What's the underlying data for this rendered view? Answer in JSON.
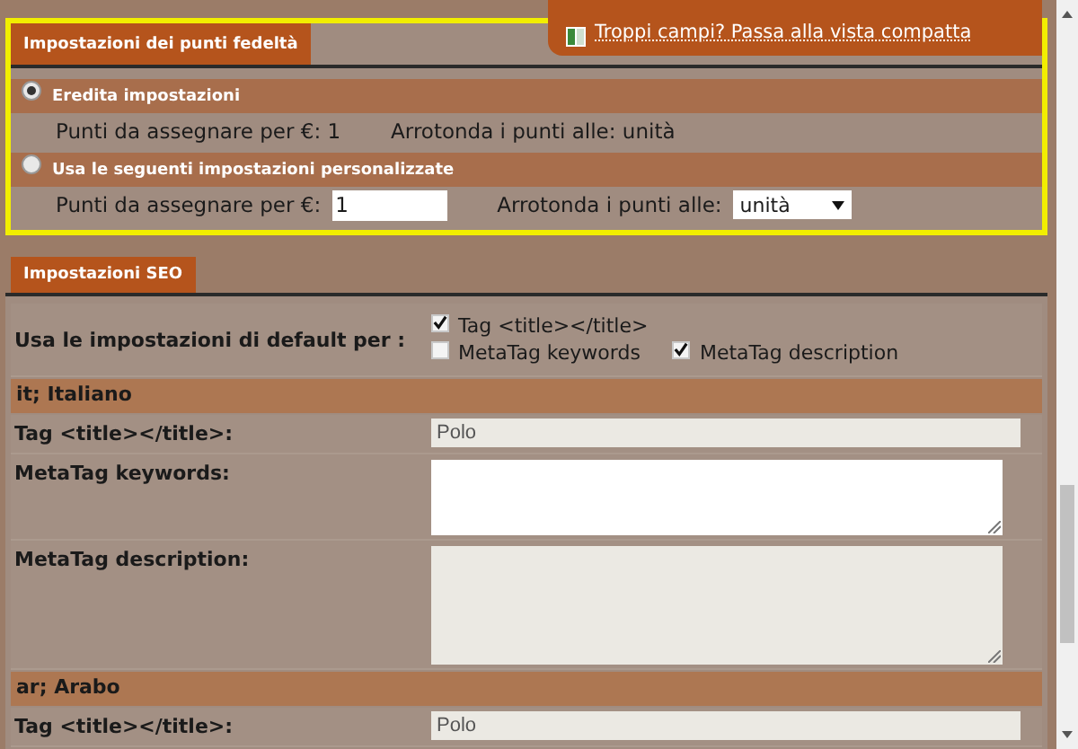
{
  "compact_link": {
    "text": "Troppi campi? Passa alla vista compatta"
  },
  "loyalty": {
    "tab": "Impostazioni dei punti fedeltà",
    "options": [
      {
        "label": "Eredita impostazioni",
        "selected": true,
        "kind": "summary",
        "points_label": "Punti da assegnare per €: 1",
        "round_label": "Arrotonda i punti alle: unità"
      },
      {
        "label": "Usa le seguenti impostazioni personalizzate",
        "selected": false,
        "kind": "form",
        "points_label": "Punti da assegnare per €:",
        "points_value": "1",
        "round_label": "Arrotonda i punti alle:",
        "round_value": "unità"
      }
    ]
  },
  "seo": {
    "tab": "Impostazioni SEO",
    "defaults_label": "Usa le impostazioni di default per :",
    "defaults": [
      {
        "label": "Tag <title></title>",
        "checked": true
      },
      {
        "label": "MetaTag keywords",
        "checked": false
      },
      {
        "label": "MetaTag description",
        "checked": true
      }
    ],
    "languages": [
      {
        "name": "it; Italiano",
        "fields": [
          {
            "label": "Tag <title></title>:",
            "kind": "line",
            "value": "Polo",
            "disabled": true
          },
          {
            "label": "MetaTag keywords:",
            "kind": "area",
            "disabled": false
          },
          {
            "label": "MetaTag description:",
            "kind": "area",
            "disabled": true
          }
        ]
      },
      {
        "name": "ar; Arabo",
        "fields": [
          {
            "label": "Tag <title></title>:",
            "kind": "line",
            "value": "Polo",
            "disabled": true
          }
        ]
      }
    ]
  }
}
